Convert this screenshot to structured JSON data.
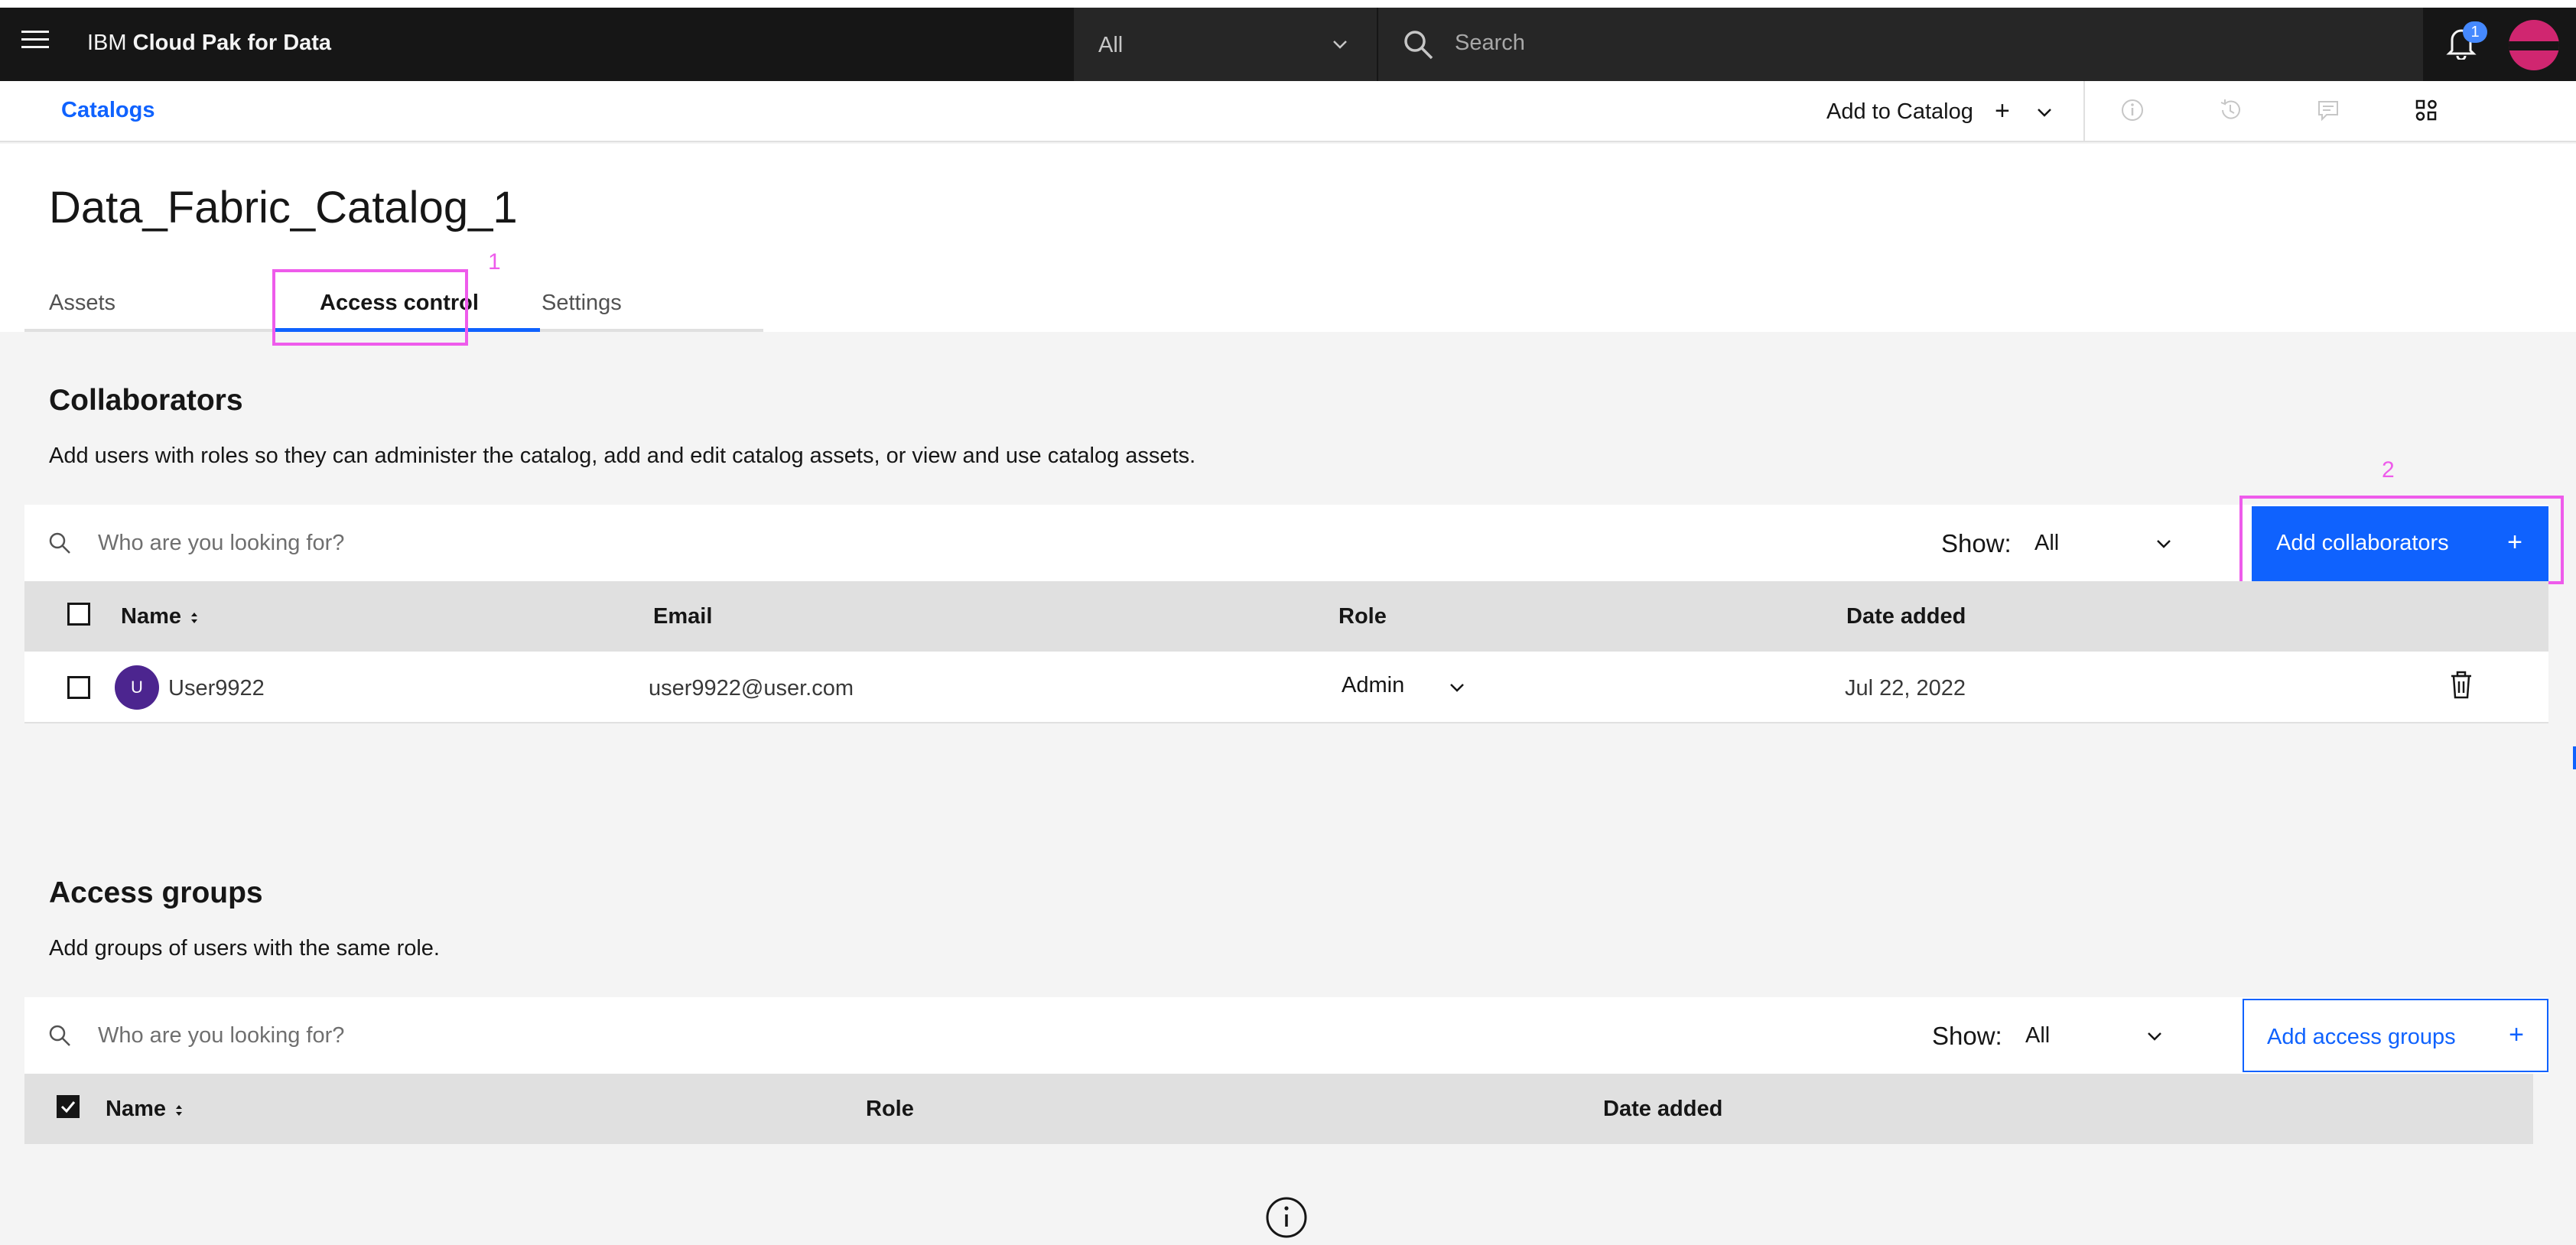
{
  "header": {
    "brand_prefix": "IBM",
    "brand_name": "Cloud Pak for Data",
    "scope_value": "All",
    "search_placeholder": "Search",
    "notification_count": "1"
  },
  "subbar": {
    "breadcrumb": "Catalogs",
    "add_to_catalog": "Add to Catalog",
    "add_plus": "+"
  },
  "page": {
    "title": "Data_Fabric_Catalog_1",
    "tabs": [
      {
        "label": "Assets",
        "active": false
      },
      {
        "label": "Access control",
        "active": true
      },
      {
        "label": "Settings",
        "active": false
      }
    ]
  },
  "annotations": {
    "marker_1": "1",
    "marker_2": "2"
  },
  "collaborators": {
    "title": "Collaborators",
    "description": "Add users with roles so they can administer the catalog, add and edit catalog assets, or view and use catalog assets.",
    "search_placeholder": "Who are you looking for?",
    "show_label": "Show:",
    "show_value": "All",
    "add_button": "Add collaborators",
    "add_button_icon": "+",
    "columns": [
      "Name",
      "Email",
      "Role",
      "Date added"
    ],
    "rows": [
      {
        "avatar": "U",
        "name": "User9922",
        "email": "user9922@user.com",
        "role": "Admin",
        "date_added": "Jul 22, 2022"
      }
    ]
  },
  "access_groups": {
    "title": "Access groups",
    "description": "Add groups of users with the same role.",
    "search_placeholder": "Who are you looking for?",
    "show_label": "Show:",
    "show_value": "All",
    "add_button": "Add access groups",
    "add_button_icon": "+",
    "columns": [
      "Name",
      "Role",
      "Date added"
    ]
  },
  "colors": {
    "accent": "#0f62fe",
    "header_bg": "#161616",
    "highlight": "#ee5beb",
    "avatar_user": "#4c258f",
    "avatar_top": "#d02670"
  }
}
